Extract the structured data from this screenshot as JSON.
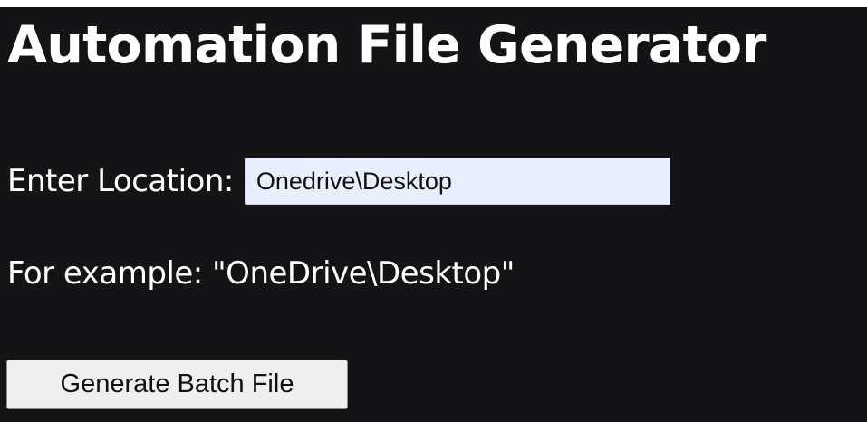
{
  "header": {
    "title": "Automation File Generator"
  },
  "form": {
    "location_label": "Enter Location:",
    "location_value": "Onedrive\\Desktop",
    "example_text": "For example: \"OneDrive\\Desktop\"",
    "generate_button_label": "Generate Batch File"
  },
  "colors": {
    "background": "#141416",
    "text": "#ffffff",
    "input_background": "#e9efff",
    "button_background": "#efefef"
  }
}
